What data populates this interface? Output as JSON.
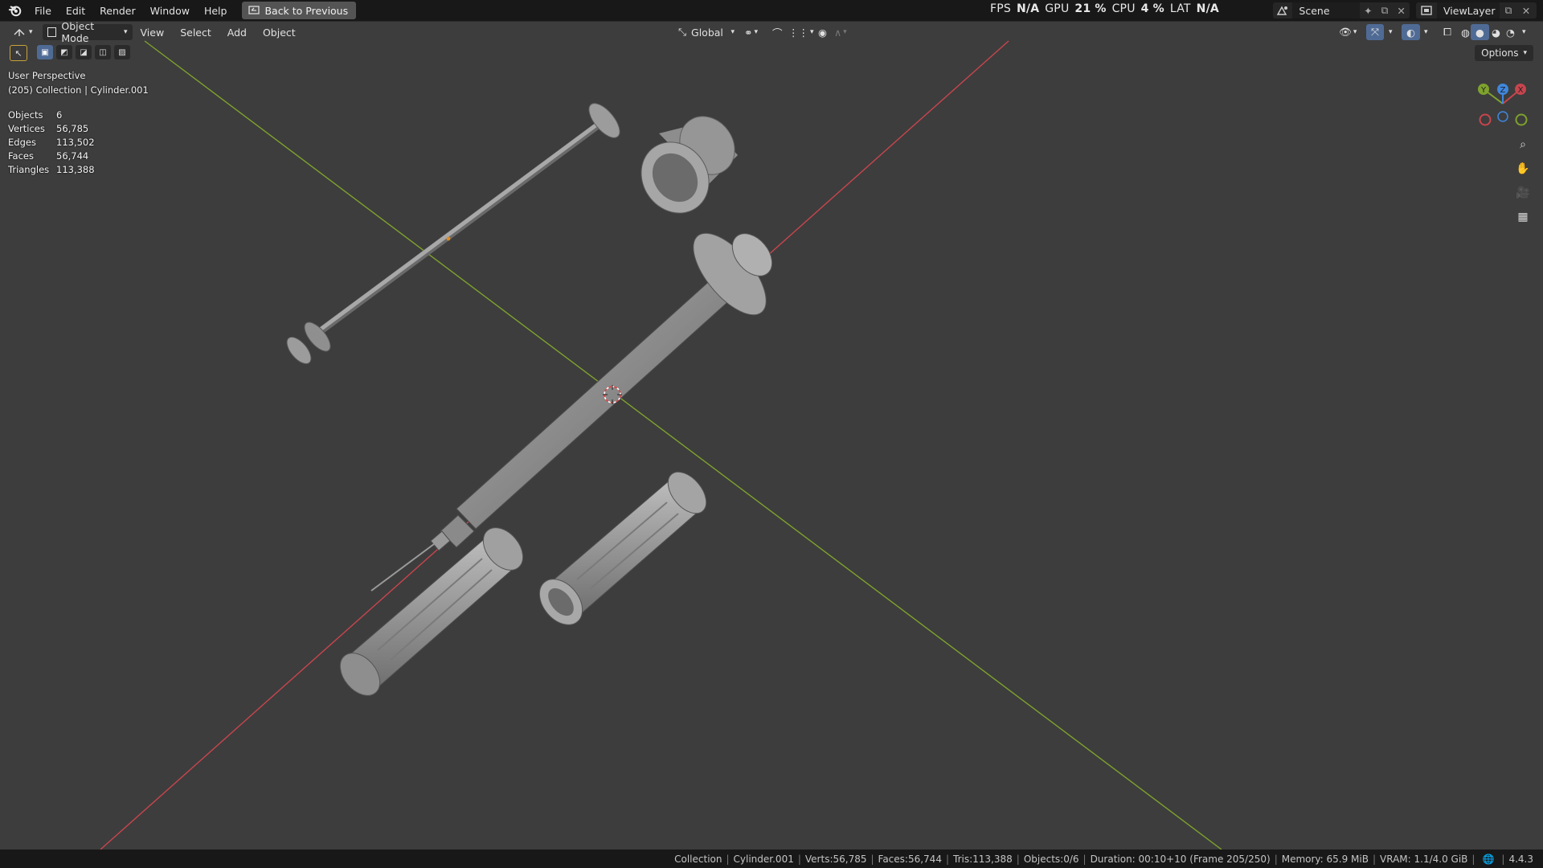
{
  "menubar": {
    "items": [
      "File",
      "Edit",
      "Render",
      "Window",
      "Help"
    ],
    "back_button": "Back to Previous",
    "perf": {
      "fps_label": "FPS",
      "fps_value": "N/A",
      "gpu_label": "GPU",
      "gpu_value": "21 %",
      "cpu_label": "CPU",
      "cpu_value": "4 %",
      "lat_label": "LAT",
      "lat_value": "N/A"
    },
    "scene": "Scene",
    "view_layer": "ViewLayer"
  },
  "viewport_header": {
    "mode": "Object Mode",
    "menus": [
      "View",
      "Select",
      "Add",
      "Object"
    ],
    "transform_orientation": "Global",
    "options": "Options"
  },
  "overlay": {
    "perspective": "User Perspective",
    "collection_info": "(205) Collection | Cylinder.001",
    "stats": [
      {
        "label": "Objects",
        "value": "6"
      },
      {
        "label": "Vertices",
        "value": "56,785"
      },
      {
        "label": "Edges",
        "value": "113,502"
      },
      {
        "label": "Faces",
        "value": "56,744"
      },
      {
        "label": "Triangles",
        "value": "113,388"
      }
    ]
  },
  "gizmo": {
    "x": "X",
    "y": "Y",
    "z": "Z"
  },
  "statusbar": {
    "items": [
      "Collection",
      "Cylinder.001",
      "Verts:56,785",
      "Faces:56,744",
      "Tris:113,388",
      "Objects:0/6",
      "Duration: 00:10+10 (Frame 205/250)",
      "Memory: 65.9 MiB",
      "VRAM: 1.1/4.0 GiB"
    ],
    "version": "4.4.3"
  },
  "colors": {
    "viewport_bg": "#3d3d3d",
    "x_axis": "#c8454e",
    "y_axis": "#7ea22d",
    "z_axis": "#3f87df",
    "select_blue": "#4f6b95"
  }
}
